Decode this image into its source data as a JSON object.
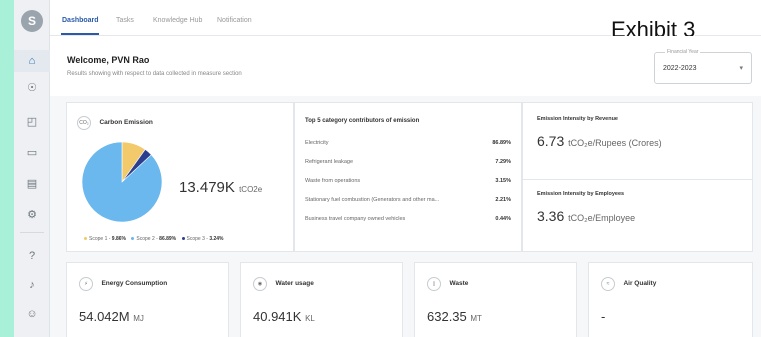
{
  "sidebar": {
    "logo": "S",
    "icons": [
      "home-icon",
      "compass-icon",
      "globe-icon",
      "laptop-icon",
      "chart-icon",
      "gear-icon",
      "help-icon",
      "bell-icon",
      "user-icon"
    ]
  },
  "nav": {
    "tabs": [
      "Dashboard",
      "Tasks",
      "Knowledge Hub",
      "Notification"
    ]
  },
  "exhibit_label": "Exhibit 3",
  "welcome": {
    "title": "Welcome, PVN Rao",
    "subtitle": "Results showing with respect to data collected in measure section"
  },
  "financial_year": {
    "label": "Financial Year",
    "value": "2022-2023"
  },
  "carbon": {
    "badge": "CO₂",
    "title": "Carbon Emission",
    "value": "13.479K",
    "unit": "tCO2e",
    "legend": [
      {
        "name": "Scope 1 - ",
        "value": "9.86%",
        "color": "#f2c96b"
      },
      {
        "name": "Scope 2 - ",
        "value": "86.89%",
        "color": "#6ab8ee"
      },
      {
        "name": "Scope 3 - ",
        "value": "3.24%",
        "color": "#2c3f8f"
      }
    ]
  },
  "chart_data": {
    "type": "pie",
    "categories": [
      "Scope 1",
      "Scope 2",
      "Scope 3"
    ],
    "values": [
      9.86,
      86.89,
      3.24
    ],
    "colors": [
      "#f2c96b",
      "#6ab8ee",
      "#2c3f8f"
    ]
  },
  "top5": {
    "title": "Top 5 category contributors of emission",
    "rows": [
      {
        "label": "Electricity",
        "pct": "86.89%"
      },
      {
        "label": "Refrigerant leakage",
        "pct": "7.29%"
      },
      {
        "label": "Waste from operations",
        "pct": "3.15%"
      },
      {
        "label": "Stationary fuel combustion (Generators and other ma...",
        "pct": "2.21%"
      },
      {
        "label": "Business travel company owned vehicles",
        "pct": "0.44%"
      }
    ]
  },
  "intensity": {
    "revenue_title": "Emission Intensity by Revenue",
    "revenue_value": "6.73",
    "revenue_unit": "tCO₂e/Rupees (Crores)",
    "employees_title": "Emission Intensity by Employees",
    "employees_value": "3.36",
    "employees_unit": "tCO₂e/Employee"
  },
  "metrics": [
    {
      "title": "Energy Consumption",
      "value": "54.042M",
      "unit": "MJ",
      "icon": "lightning-icon"
    },
    {
      "title": "Water usage",
      "value": "40.941K",
      "unit": "KL",
      "icon": "water-icon"
    },
    {
      "title": "Waste",
      "value": "632.35",
      "unit": "MT",
      "icon": "waste-icon"
    },
    {
      "title": "Air Quality",
      "value": "-",
      "unit": "",
      "icon": "air-icon"
    }
  ]
}
